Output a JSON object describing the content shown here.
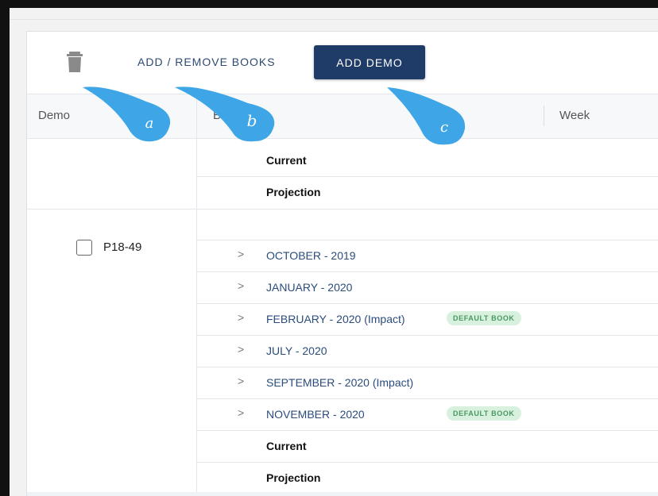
{
  "toolbar": {
    "trash_icon": "trash-icon",
    "add_remove_label": "ADD / REMOVE BOOKS",
    "add_demo_label": "ADD DEMO"
  },
  "table": {
    "headers": {
      "demo": "Demo",
      "book": "Book",
      "week": "Week"
    },
    "top_group": {
      "rows": [
        {
          "label": "Current"
        },
        {
          "label": "Projection"
        }
      ]
    },
    "demo_group": {
      "demo_label": "P18-49",
      "checked": false,
      "books": [
        {
          "label": "OCTOBER - 2019",
          "badge": ""
        },
        {
          "label": "JANUARY - 2020",
          "badge": ""
        },
        {
          "label": "FEBRUARY - 2020 (Impact)",
          "badge": "DEFAULT BOOK"
        },
        {
          "label": "JULY - 2020",
          "badge": ""
        },
        {
          "label": "SEPTEMBER - 2020 (Impact)",
          "badge": ""
        },
        {
          "label": "NOVEMBER - 2020",
          "badge": "DEFAULT BOOK"
        }
      ],
      "summary_rows": [
        {
          "label": "Current"
        },
        {
          "label": "Projection"
        }
      ]
    }
  },
  "callouts": [
    "a",
    "b",
    "c"
  ],
  "colors": {
    "primary": "#1f3b68",
    "link": "#2b4c7e",
    "callout": "#3ea6e6",
    "badge_bg": "#d8f0de",
    "badge_text": "#4a9960"
  }
}
